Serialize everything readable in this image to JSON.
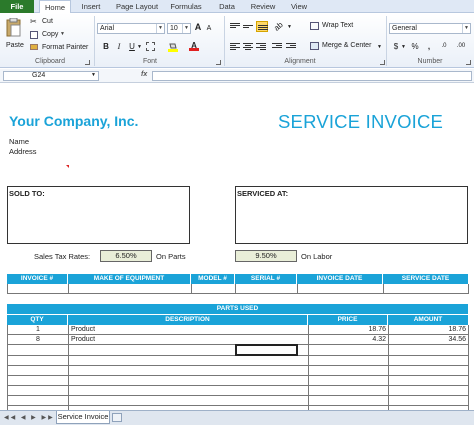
{
  "ribbon_tabs": [
    "File",
    "Home",
    "Insert",
    "Page Layout",
    "Formulas",
    "Data",
    "Review",
    "View"
  ],
  "clipboard": {
    "paste": "Paste",
    "cut": "Cut",
    "copy": "Copy",
    "format_painter": "Format Painter",
    "group_label": "Clipboard"
  },
  "font": {
    "name": "Arial",
    "size": "10",
    "bold": "B",
    "italic": "I",
    "underline": "U",
    "grow": "A",
    "shrink": "A",
    "group_label": "Font"
  },
  "alignment": {
    "wrap_text": "Wrap Text",
    "merge_center": "Merge & Center",
    "group_label": "Alignment"
  },
  "number": {
    "format": "General",
    "dollar": "$",
    "percent": "%",
    "comma": ",",
    "inc_decimal": ".0",
    "dec_decimal": ".00",
    "group_label": "Number"
  },
  "formula_bar": {
    "name_box": "G24",
    "fx": "fx",
    "value": ""
  },
  "invoice": {
    "company": "Your Company, Inc.",
    "title": "SERVICE INVOICE",
    "name_label": "Name",
    "address_label": "Address",
    "sold_to": "SOLD TO:",
    "serviced_at": "SERVICED AT:",
    "sales_tax_label": "Sales Tax Rates:",
    "tax_parts": "6.50%",
    "on_parts": "On Parts",
    "tax_labor": "9.50%",
    "on_labor": "On Labor"
  },
  "equipment_headers": [
    "INVOICE #",
    "MAKE OF EQUIPMENT",
    "MODEL #",
    "SERIAL #",
    "INVOICE DATE",
    "SERVICE DATE"
  ],
  "parts": {
    "title": "PARTS USED",
    "headers": [
      "QTY",
      "DESCRIPTION",
      "PRICE",
      "AMOUNT"
    ],
    "rows": [
      {
        "qty": "1",
        "description": "Product",
        "price": "18.76",
        "amount": "18.76"
      },
      {
        "qty": "8",
        "description": "Product",
        "price": "4.32",
        "amount": "34.56"
      }
    ]
  },
  "sheet_tab": "Service Invoice",
  "colors": {
    "accent": "#1aa3d8",
    "file_tab": "#2b7a2b",
    "rate_fill": "#e9eed8"
  }
}
